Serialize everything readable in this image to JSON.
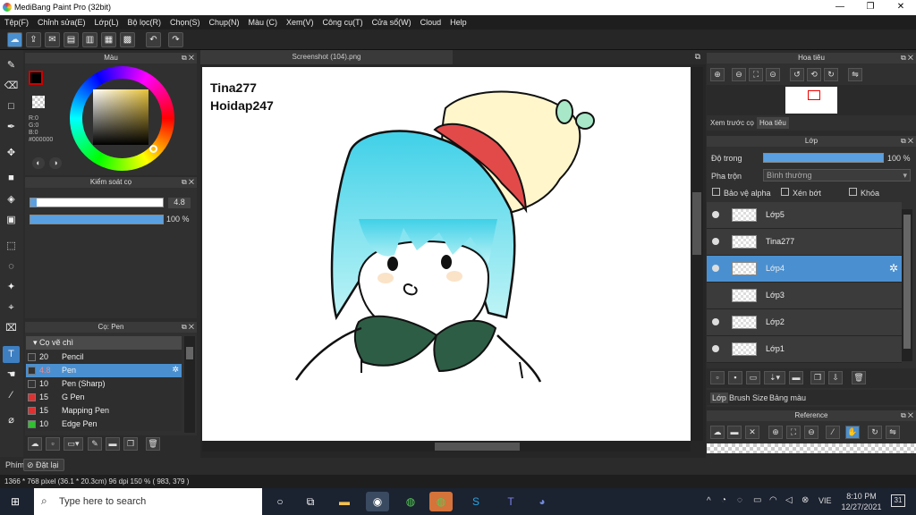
{
  "window": {
    "title": "MediBang Paint Pro (32bit)"
  },
  "menu": [
    "Tệp(F)",
    "Chỉnh sửa(E)",
    "Lớp(L)",
    "Bộ lọc(R)",
    "Chọn(S)",
    "Chụp(N)",
    "Màu (C)",
    "Xem(V)",
    "Công cụ(T)",
    "Cửa sổ(W)",
    "Cloud",
    "Help"
  ],
  "color_panel": {
    "title": "Màu",
    "r": "R:0",
    "g": "G:0",
    "b": "B:0",
    "hex": "#000000"
  },
  "brush_control": {
    "title": "Kiểm soát cọ",
    "size": "4.8",
    "opacity": "100 %",
    "size_fraction": 0.05,
    "opacity_fraction": 1.0
  },
  "brush_panel": {
    "title": "Cọ: Pen",
    "group": "Cọ vẽ chì",
    "items": [
      {
        "size": "20",
        "name": "Pencil",
        "color": "#333333"
      },
      {
        "size": "4.8",
        "name": "Pen",
        "color": "#333333"
      },
      {
        "size": "10",
        "name": "Pen (Sharp)",
        "color": "#333333"
      },
      {
        "size": "15",
        "name": "G Pen",
        "color": "#e03030"
      },
      {
        "size": "15",
        "name": "Mapping Pen",
        "color": "#e03030"
      },
      {
        "size": "10",
        "name": "Edge Pen",
        "color": "#30c030"
      }
    ]
  },
  "bottom_left": {
    "tab": "Phím",
    "reset": "Đặt lại"
  },
  "canvas": {
    "tab": "Screenshot (104).png",
    "text1": "Tina277",
    "text2": "Hoidap247"
  },
  "navigator": {
    "title": "Hoa tiêu",
    "tab1": "Xem trước cọ",
    "tab2": "Hoa tiêu"
  },
  "layer_panel": {
    "title": "Lớp",
    "opacity_label": "Độ trong",
    "opacity_value": "100 %",
    "blend_label": "Pha trộn",
    "blend_value": "Bình thường",
    "protect_alpha": "Bảo vệ alpha",
    "clipping": "Xén bớt",
    "lock": "Khóa",
    "layers": [
      "Lớp5",
      "Tina277",
      "Lớp4",
      "Lớp3",
      "Lớp2",
      "Lớp1"
    ],
    "tabs": [
      "Lớp",
      "Brush Size",
      "Bảng màu"
    ]
  },
  "reference": {
    "title": "Reference"
  },
  "status": "1366 * 768 pixel   (36.1 * 20.3cm)   96 dpi   150 %   ( 983, 379 )",
  "taskbar": {
    "search": "Type here to search",
    "lang": "VIE",
    "time": "8:10 PM",
    "date": "12/27/2021",
    "notif": "31"
  }
}
